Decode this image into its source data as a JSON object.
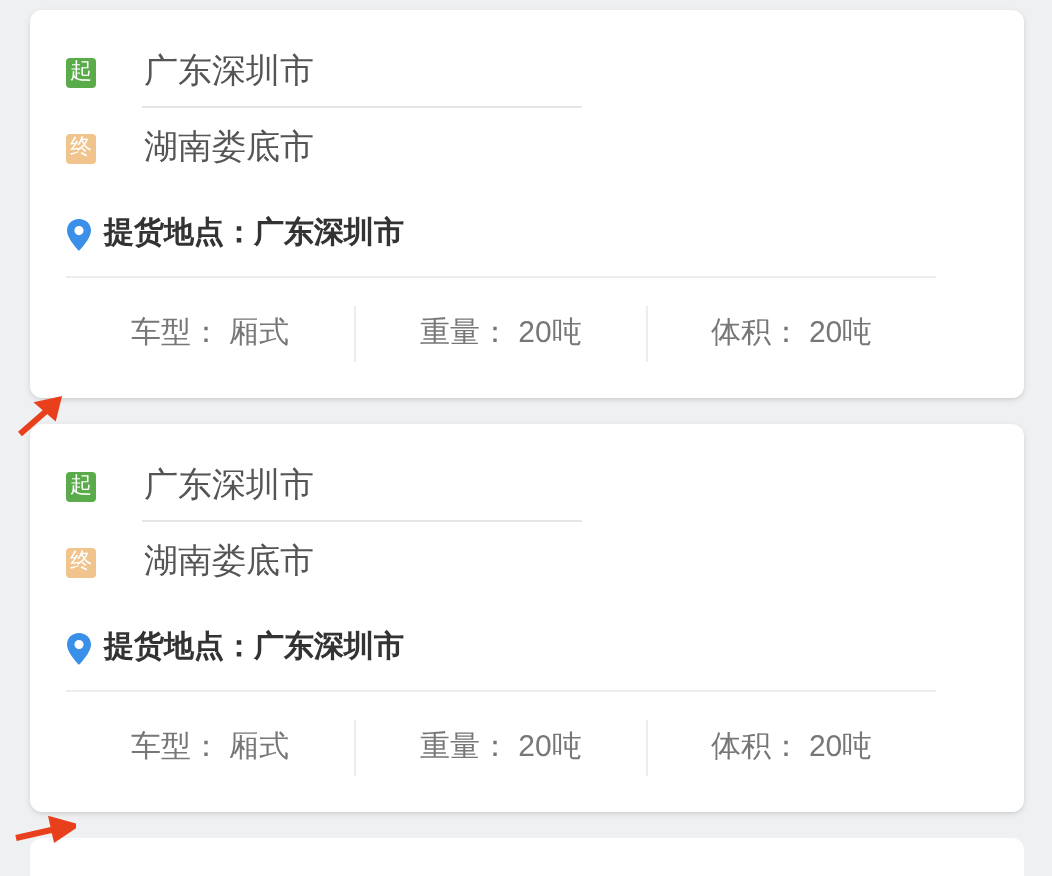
{
  "orders": [
    {
      "origin_badge": "起",
      "origin": "广东深圳市",
      "destination_badge": "终",
      "destination": "湖南娄底市",
      "pickup_label": "提货地点：",
      "pickup": "广东深圳市",
      "specs": [
        {
          "label": "车型：",
          "value": "厢式"
        },
        {
          "label": "重量：",
          "value": "20吨"
        },
        {
          "label": "体积：",
          "value": "20吨"
        }
      ]
    },
    {
      "origin_badge": "起",
      "origin": "广东深圳市",
      "destination_badge": "终",
      "destination": "湖南娄底市",
      "pickup_label": "提货地点：",
      "pickup": "广东深圳市",
      "specs": [
        {
          "label": "车型：",
          "value": "厢式"
        },
        {
          "label": "重量：",
          "value": "20吨"
        },
        {
          "label": "体积：",
          "value": "20吨"
        }
      ]
    }
  ]
}
